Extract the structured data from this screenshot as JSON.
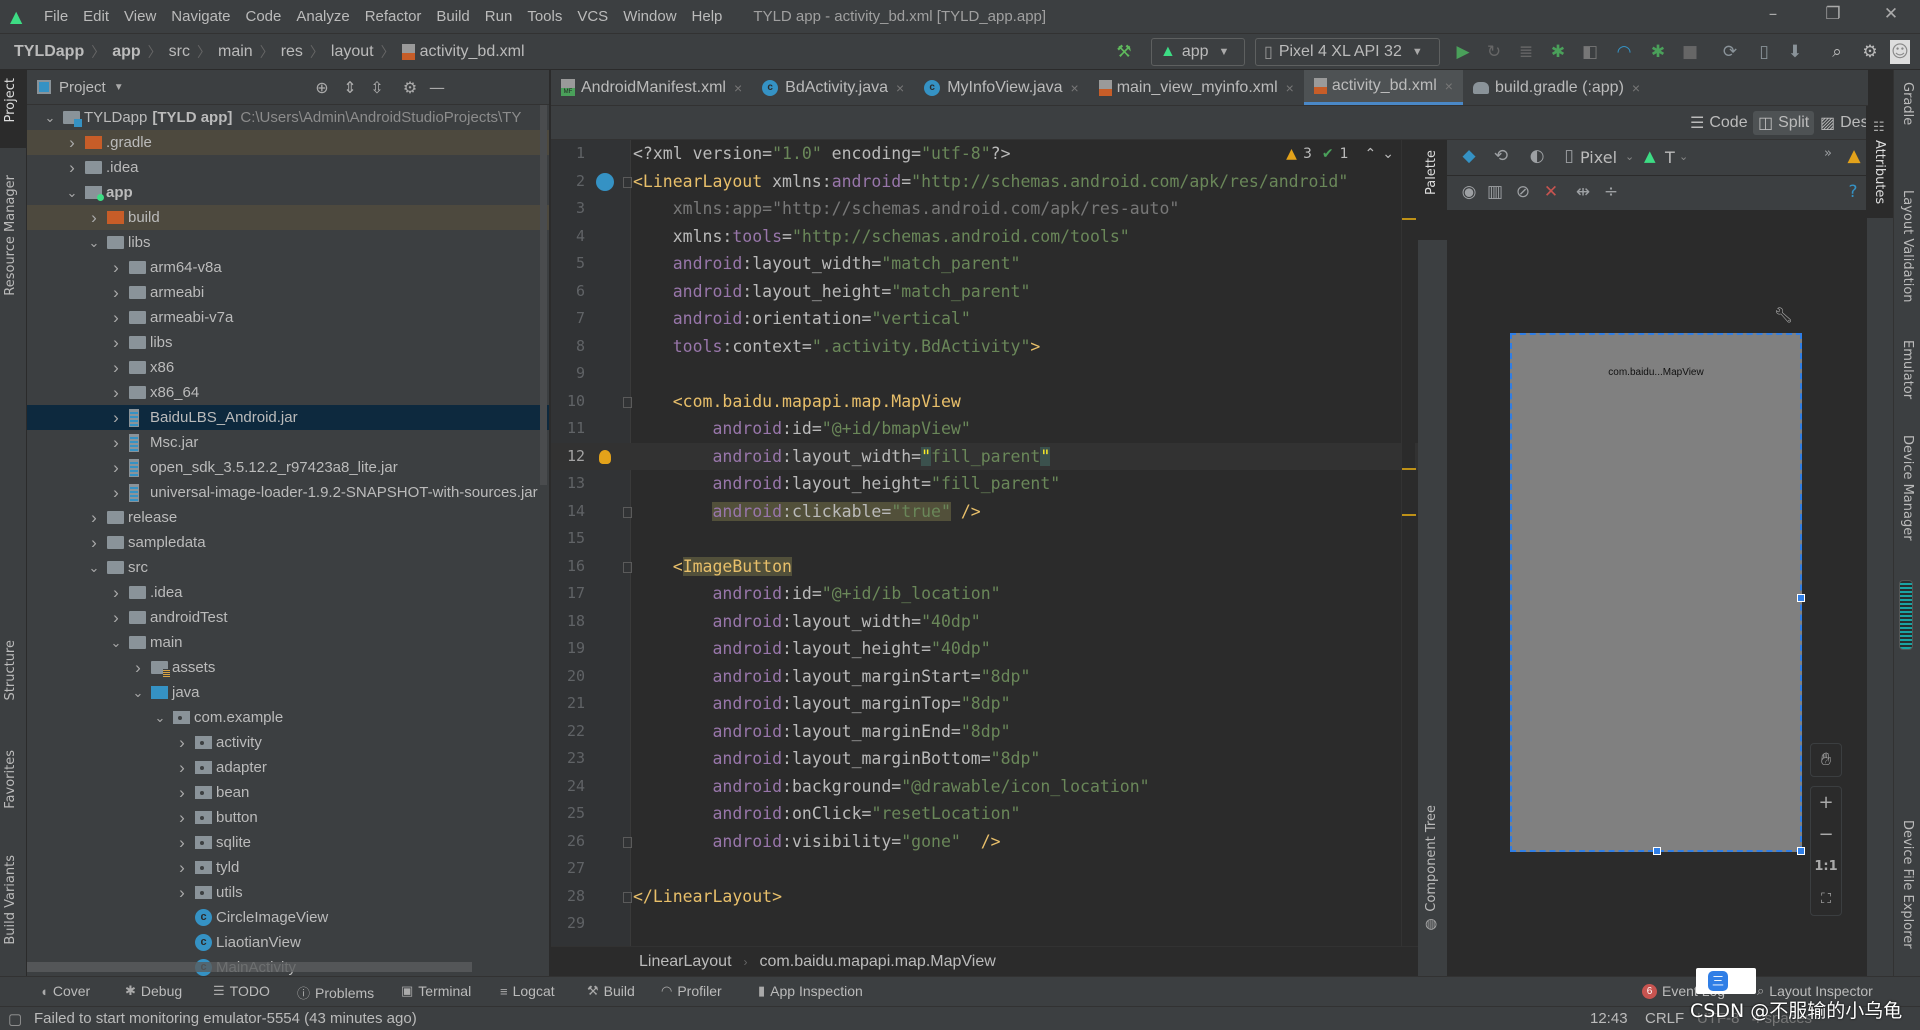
{
  "menubar": {
    "items": [
      "File",
      "Edit",
      "View",
      "Navigate",
      "Code",
      "Analyze",
      "Refactor",
      "Build",
      "Run",
      "Tools",
      "VCS",
      "Window",
      "Help"
    ],
    "window_title": "TYLD app - activity_bd.xml [TYLD_app.app]",
    "controls": {
      "minimize": "–",
      "restore": "❐",
      "close": "✕"
    }
  },
  "navbar": {
    "breadcrumb": [
      "TYLDapp",
      "app",
      "src",
      "main",
      "res",
      "layout",
      "activity_bd.xml"
    ],
    "run_config": "app",
    "device": "Pixel 4 XL API 32",
    "toolbar_icons": [
      "hammer-icon",
      "run-icon",
      "apply-changes-icon",
      "apply-code-changes-icon",
      "debug-icon",
      "profile-icon",
      "attach-debugger-icon",
      "stop-icon",
      "gradle-sync-icon",
      "avd-manager-icon",
      "sdk-manager-icon",
      "search-icon",
      "settings-icon",
      "avatar"
    ]
  },
  "left_strip": [
    "Project",
    "Resource Manager",
    "Structure",
    "Favorites",
    "Build Variants"
  ],
  "project": {
    "title": "Project",
    "tree": [
      {
        "depth": 0,
        "state": "open",
        "icon": "root",
        "name": "TYLDapp",
        "bold": "[TYLD app]",
        "path": "C:\\Users\\Admin\\AndroidStudioProjects\\TY"
      },
      {
        "depth": 1,
        "state": "closed",
        "icon": "orange",
        "name": ".gradle",
        "hl": true
      },
      {
        "depth": 1,
        "state": "closed",
        "icon": "folder",
        "name": ".idea"
      },
      {
        "depth": 1,
        "state": "open",
        "icon": "module",
        "name": "app",
        "boldname": true
      },
      {
        "depth": 2,
        "state": "closed",
        "icon": "orange",
        "name": "build",
        "hl": true
      },
      {
        "depth": 2,
        "state": "open",
        "icon": "folder",
        "name": "libs"
      },
      {
        "depth": 3,
        "state": "closed",
        "icon": "folder",
        "name": "arm64-v8a"
      },
      {
        "depth": 3,
        "state": "closed",
        "icon": "folder",
        "name": "armeabi"
      },
      {
        "depth": 3,
        "state": "closed",
        "icon": "folder",
        "name": "armeabi-v7a"
      },
      {
        "depth": 3,
        "state": "closed",
        "icon": "folder",
        "name": "libs"
      },
      {
        "depth": 3,
        "state": "closed",
        "icon": "folder",
        "name": "x86"
      },
      {
        "depth": 3,
        "state": "closed",
        "icon": "folder",
        "name": "x86_64"
      },
      {
        "depth": 3,
        "state": "closed",
        "icon": "jar",
        "name": "BaiduLBS_Android.jar",
        "selected": true
      },
      {
        "depth": 3,
        "state": "closed",
        "icon": "jar",
        "name": "Msc.jar"
      },
      {
        "depth": 3,
        "state": "closed",
        "icon": "jar",
        "name": "open_sdk_3.5.12.2_r97423a8_lite.jar"
      },
      {
        "depth": 3,
        "state": "closed",
        "icon": "jar",
        "name": "universal-image-loader-1.9.2-SNAPSHOT-with-sources.jar"
      },
      {
        "depth": 2,
        "state": "closed",
        "icon": "folder",
        "name": "release"
      },
      {
        "depth": 2,
        "state": "closed",
        "icon": "folder",
        "name": "sampledata"
      },
      {
        "depth": 2,
        "state": "open",
        "icon": "folder",
        "name": "src"
      },
      {
        "depth": 3,
        "state": "closed",
        "icon": "folder",
        "name": ".idea"
      },
      {
        "depth": 3,
        "state": "closed",
        "icon": "folder",
        "name": "androidTest"
      },
      {
        "depth": 3,
        "state": "open",
        "icon": "folder",
        "name": "main"
      },
      {
        "depth": 4,
        "state": "closed",
        "icon": "assets",
        "name": "assets"
      },
      {
        "depth": 4,
        "state": "open",
        "icon": "blue",
        "name": "java"
      },
      {
        "depth": 5,
        "state": "open",
        "icon": "pkg",
        "name": "com.example"
      },
      {
        "depth": 6,
        "state": "closed",
        "icon": "pkg",
        "name": "activity"
      },
      {
        "depth": 6,
        "state": "closed",
        "icon": "pkg",
        "name": "adapter"
      },
      {
        "depth": 6,
        "state": "closed",
        "icon": "pkg",
        "name": "bean"
      },
      {
        "depth": 6,
        "state": "closed",
        "icon": "pkg",
        "name": "button"
      },
      {
        "depth": 6,
        "state": "closed",
        "icon": "pkg",
        "name": "sqlite"
      },
      {
        "depth": 6,
        "state": "closed",
        "icon": "pkg",
        "name": "tyld"
      },
      {
        "depth": 6,
        "state": "closed",
        "icon": "pkg",
        "name": "utils"
      },
      {
        "depth": 6,
        "state": "none",
        "icon": "class",
        "name": "CircleImageView"
      },
      {
        "depth": 6,
        "state": "none",
        "icon": "class",
        "name": "LiaotianView"
      },
      {
        "depth": 6,
        "state": "none",
        "icon": "class",
        "name": "MainActivity"
      }
    ]
  },
  "tabs": [
    {
      "label": "AndroidManifest.xml",
      "icon": "manifest"
    },
    {
      "label": "BdActivity.java",
      "icon": "class"
    },
    {
      "label": "MyInfoView.java",
      "icon": "class"
    },
    {
      "label": "main_view_myinfo.xml",
      "icon": "xml"
    },
    {
      "label": "activity_bd.xml",
      "icon": "xml",
      "active": true
    },
    {
      "label": "build.gradle (:app)",
      "icon": "gradle"
    }
  ],
  "view_modes": {
    "code": "Code",
    "split": "Split",
    "design": "Design",
    "active": "Split"
  },
  "editor": {
    "inspections": {
      "warnings": "3",
      "weak_warnings": "1"
    },
    "current_line": 12,
    "lines": [
      {
        "n": "1",
        "tokens": [
          [
            "p",
            "<?xml version="
          ],
          [
            "v",
            "\"1.0\""
          ],
          [
            "p",
            " encoding="
          ],
          [
            "v",
            "\"utf-8\""
          ],
          [
            "p",
            "?>"
          ]
        ]
      },
      {
        "n": "2",
        "tokens": [
          [
            "t",
            "<LinearLayout"
          ],
          [
            "p",
            " xmlns:"
          ],
          [
            "n",
            "android"
          ],
          [
            "p",
            "="
          ],
          [
            "v",
            "\"http://schemas.android.com/apk/res/android\""
          ]
        ]
      },
      {
        "n": "3",
        "tokens": [
          [
            "g",
            "    xmlns:app=\"http://schemas.android.com/apk/res-auto\""
          ]
        ]
      },
      {
        "n": "4",
        "tokens": [
          [
            "p",
            "    xmlns:"
          ],
          [
            "n",
            "tools"
          ],
          [
            "p",
            "="
          ],
          [
            "v",
            "\"http://schemas.android.com/tools\""
          ]
        ]
      },
      {
        "n": "5",
        "tokens": [
          [
            "p",
            "    "
          ],
          [
            "n",
            "android"
          ],
          [
            "p",
            ":layout_width="
          ],
          [
            "v",
            "\"match_parent\""
          ]
        ]
      },
      {
        "n": "6",
        "tokens": [
          [
            "p",
            "    "
          ],
          [
            "n",
            "android"
          ],
          [
            "p",
            ":layout_height="
          ],
          [
            "v",
            "\"match_parent\""
          ]
        ]
      },
      {
        "n": "7",
        "tokens": [
          [
            "p",
            "    "
          ],
          [
            "n",
            "android"
          ],
          [
            "p",
            ":orientation="
          ],
          [
            "v",
            "\"vertical\""
          ]
        ]
      },
      {
        "n": "8",
        "tokens": [
          [
            "p",
            "    "
          ],
          [
            "n",
            "tools"
          ],
          [
            "p",
            ":context="
          ],
          [
            "v",
            "\".activity.BdActivity\""
          ],
          [
            "t",
            ">"
          ]
        ]
      },
      {
        "n": "9",
        "tokens": []
      },
      {
        "n": "10",
        "tokens": [
          [
            "p",
            "    "
          ],
          [
            "t",
            "<com.baidu.mapapi.map.MapView"
          ]
        ]
      },
      {
        "n": "11",
        "tokens": [
          [
            "p",
            "        "
          ],
          [
            "n",
            "android"
          ],
          [
            "p",
            ":id="
          ],
          [
            "v",
            "\"@+id/bmapView\""
          ]
        ]
      },
      {
        "n": "12",
        "tokens": [
          [
            "p",
            "        "
          ],
          [
            "n",
            "android"
          ],
          [
            "p",
            ":layout_width="
          ],
          [
            "q",
            "\""
          ],
          [
            "v",
            "fill_parent"
          ],
          [
            "q",
            "\""
          ]
        ]
      },
      {
        "n": "13",
        "tokens": [
          [
            "p",
            "        "
          ],
          [
            "n",
            "android"
          ],
          [
            "p",
            ":layout_height="
          ],
          [
            "v",
            "\"fill_parent\""
          ]
        ]
      },
      {
        "n": "14",
        "tokens": [
          [
            "p",
            "        "
          ],
          [
            "nh",
            "android"
          ],
          [
            "ph",
            ":clickable="
          ],
          [
            "vh",
            "\"true\""
          ],
          [
            "t",
            " />"
          ]
        ]
      },
      {
        "n": "15",
        "tokens": []
      },
      {
        "n": "16",
        "tokens": [
          [
            "p",
            "    "
          ],
          [
            "t",
            "<"
          ],
          [
            "th",
            "ImageButton"
          ]
        ]
      },
      {
        "n": "17",
        "tokens": [
          [
            "p",
            "        "
          ],
          [
            "n",
            "android"
          ],
          [
            "p",
            ":id="
          ],
          [
            "v",
            "\"@+id/ib_location\""
          ]
        ]
      },
      {
        "n": "18",
        "tokens": [
          [
            "p",
            "        "
          ],
          [
            "n",
            "android"
          ],
          [
            "p",
            ":layout_width="
          ],
          [
            "v",
            "\"40dp\""
          ]
        ]
      },
      {
        "n": "19",
        "tokens": [
          [
            "p",
            "        "
          ],
          [
            "n",
            "android"
          ],
          [
            "p",
            ":layout_height="
          ],
          [
            "v",
            "\"40dp\""
          ]
        ]
      },
      {
        "n": "20",
        "tokens": [
          [
            "p",
            "        "
          ],
          [
            "n",
            "android"
          ],
          [
            "p",
            ":layout_marginStart="
          ],
          [
            "v",
            "\"8dp\""
          ]
        ]
      },
      {
        "n": "21",
        "tokens": [
          [
            "p",
            "        "
          ],
          [
            "n",
            "android"
          ],
          [
            "p",
            ":layout_marginTop="
          ],
          [
            "v",
            "\"8dp\""
          ]
        ]
      },
      {
        "n": "22",
        "tokens": [
          [
            "p",
            "        "
          ],
          [
            "n",
            "android"
          ],
          [
            "p",
            ":layout_marginEnd="
          ],
          [
            "v",
            "\"8dp\""
          ]
        ]
      },
      {
        "n": "23",
        "tokens": [
          [
            "p",
            "        "
          ],
          [
            "n",
            "android"
          ],
          [
            "p",
            ":layout_marginBottom="
          ],
          [
            "v",
            "\"8dp\""
          ]
        ]
      },
      {
        "n": "24",
        "tokens": [
          [
            "p",
            "        "
          ],
          [
            "n",
            "android"
          ],
          [
            "p",
            ":background="
          ],
          [
            "v",
            "\"@drawable/icon_location\""
          ]
        ]
      },
      {
        "n": "25",
        "tokens": [
          [
            "p",
            "        "
          ],
          [
            "n",
            "android"
          ],
          [
            "p",
            ":onClick="
          ],
          [
            "v",
            "\"resetLocation\""
          ]
        ]
      },
      {
        "n": "26",
        "tokens": [
          [
            "p",
            "        "
          ],
          [
            "n",
            "android"
          ],
          [
            "p",
            ":visibility="
          ],
          [
            "v",
            "\"gone\""
          ],
          [
            "t",
            "  />"
          ]
        ]
      },
      {
        "n": "27",
        "tokens": []
      },
      {
        "n": "28",
        "tokens": [
          [
            "t",
            "</LinearLayout>"
          ]
        ]
      },
      {
        "n": "29",
        "tokens": []
      }
    ],
    "breadcrumb": [
      "LinearLayout",
      "com.baidu.mapapi.map.MapView"
    ]
  },
  "design": {
    "palette_label": "Palette",
    "component_tree_label": "Component Tree",
    "device": "Pixel",
    "api": "T",
    "preview_label": "com.baidu...MapView",
    "zoom_fit": "1:1"
  },
  "right_strip": {
    "attributes": "Attributes",
    "items": [
      "Gradle",
      "Layout Validation",
      "Emulator",
      "Device Manager",
      "Device File Explorer"
    ]
  },
  "tool_windows": {
    "left": [
      "Cover",
      "Debug",
      "TODO",
      "Problems",
      "Terminal",
      "Logcat",
      "Build",
      "Profiler",
      "App Inspection"
    ],
    "event_log": "Event Log",
    "event_count": "6",
    "layout_inspector": "Layout Inspector"
  },
  "status": {
    "message": "Failed to start monitoring emulator-5554 (43 minutes ago)",
    "time": "12:43",
    "line_sep": "CRLF",
    "encoding": "UTF-8",
    "indent": "4 spaces"
  },
  "watermark": "CSDN @不服输的小乌龟",
  "colors": {
    "accent": "#4a88c7",
    "tag": "#e8bf6a",
    "namespace": "#9876aa",
    "value": "#6a8759",
    "android_green": "#3ddc84"
  }
}
